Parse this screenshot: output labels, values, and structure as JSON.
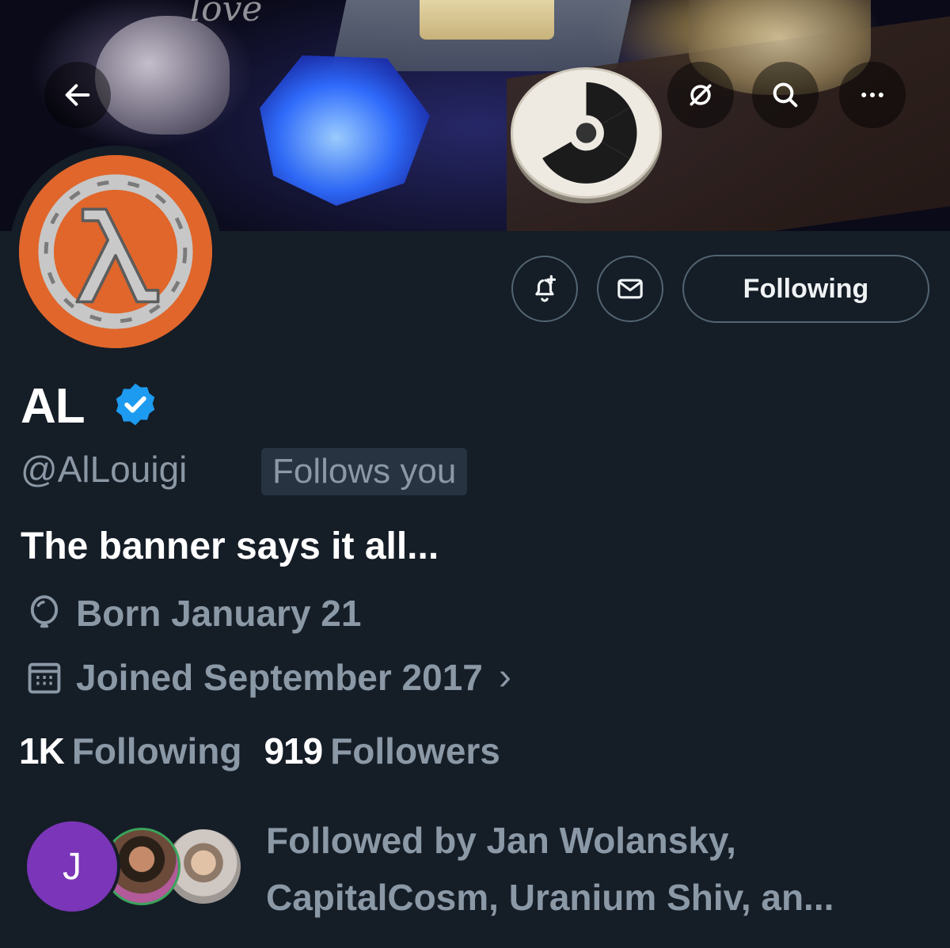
{
  "banner": {
    "script_text": "love",
    "back_icon": "arrow-left-icon",
    "grok_icon": "grok-icon",
    "search_icon": "search-icon",
    "more_icon": "more-horizontal-icon"
  },
  "profile": {
    "display_name": "AL",
    "verified": true,
    "handle": "@AlLouigi",
    "follows_you_label": "Follows you",
    "bio": "The banner says it all...",
    "born": "Born January 21",
    "joined": "Joined September 2017",
    "joined_chevron": "›"
  },
  "actions": {
    "notify_icon": "bell-plus-icon",
    "message_icon": "envelope-icon",
    "following_label": "Following"
  },
  "stats": {
    "following_count": "1K",
    "following_label": "Following",
    "followers_count": "919",
    "followers_label": "Followers"
  },
  "followed_by": {
    "first_avatar_initial": "J",
    "text": "Followed by Jan Wolansky, CapitalCosm, Uranium Shiv, an..."
  },
  "colors": {
    "background": "#151d27",
    "muted_text": "#8b98a5",
    "verified_blue": "#1d9bf0",
    "avatar_orange": "#e0662b"
  }
}
